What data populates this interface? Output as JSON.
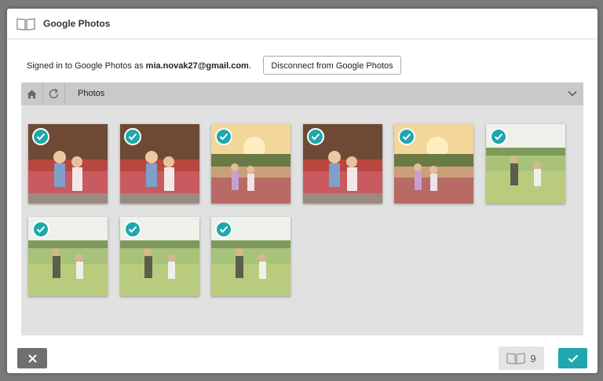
{
  "dialog": {
    "title": "Google Photos",
    "signed_in_prefix": "Signed in to Google Photos as ",
    "email": "mia.novak27@gmail.com",
    "signed_in_suffix": ".",
    "disconnect_label": "Disconnect from Google Photos"
  },
  "browser": {
    "folder_title": "Photos",
    "photos": [
      {
        "scene": "autumn",
        "selected": true
      },
      {
        "scene": "autumn",
        "selected": true
      },
      {
        "scene": "sunset",
        "selected": true
      },
      {
        "scene": "autumn",
        "selected": true
      },
      {
        "scene": "sunset",
        "selected": true
      },
      {
        "scene": "meadow",
        "selected": true
      },
      {
        "scene": "meadow",
        "selected": true
      },
      {
        "scene": "meadow",
        "selected": true
      },
      {
        "scene": "meadow",
        "selected": true
      }
    ]
  },
  "footer": {
    "selected_count": "9"
  },
  "colors": {
    "accent": "#1fa7ad",
    "cancel": "#6f6f6f",
    "panel": "#e1e1e1",
    "toolbar": "#c9c9c9"
  }
}
